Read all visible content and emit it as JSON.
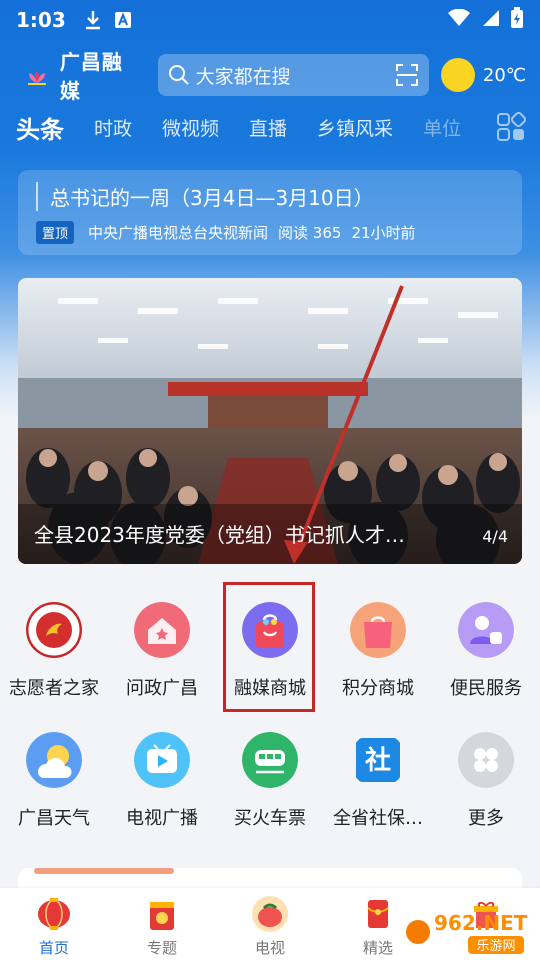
{
  "status_bar": {
    "time": "1:03"
  },
  "header": {
    "logo_text": "广昌融媒",
    "search_placeholder": "大家都在搜",
    "temperature": "20℃"
  },
  "channels": [
    {
      "label": "头条",
      "active": true
    },
    {
      "label": "时政"
    },
    {
      "label": "微视频"
    },
    {
      "label": "直播"
    },
    {
      "label": "乡镇风采"
    },
    {
      "label": "单位"
    }
  ],
  "top_news": {
    "title": "总书记的一周（3月4日—3月10日）",
    "pin": "置顶",
    "source": "中央广播电视总台央视新闻",
    "reads": "阅读 365",
    "time": "21小时前"
  },
  "banner": {
    "caption": "全县2023年度党委（党组）书记抓人才…",
    "counter": "4/4"
  },
  "services": {
    "row1": [
      {
        "label": "志愿者之家",
        "icon": "volunteer-emblem-icon"
      },
      {
        "label": "问政广昌",
        "icon": "inquiry-icon"
      },
      {
        "label": "融媒商城",
        "icon": "shopping-bag-icon"
      },
      {
        "label": "积分商城",
        "icon": "points-bag-icon"
      },
      {
        "label": "便民服务",
        "icon": "service-people-icon"
      }
    ],
    "row2": [
      {
        "label": "广昌天气",
        "icon": "weather-icon"
      },
      {
        "label": "电视广播",
        "icon": "tv-icon"
      },
      {
        "label": "买火车票",
        "icon": "train-icon"
      },
      {
        "label": "全省社保…",
        "icon": "social-security-icon"
      },
      {
        "label": "更多",
        "icon": "more-icon"
      }
    ]
  },
  "bottom_nav": [
    {
      "label": "首页",
      "active": true
    },
    {
      "label": "专题"
    },
    {
      "label": "电视"
    },
    {
      "label": "精选"
    },
    {
      "label": ""
    }
  ],
  "watermark": {
    "text_top": "962.NET",
    "text_bottom": "乐游网"
  },
  "colors": {
    "header_blue": "#1a79dd",
    "highlight_red": "#c62828",
    "active_nav": "#1f6fd8"
  }
}
